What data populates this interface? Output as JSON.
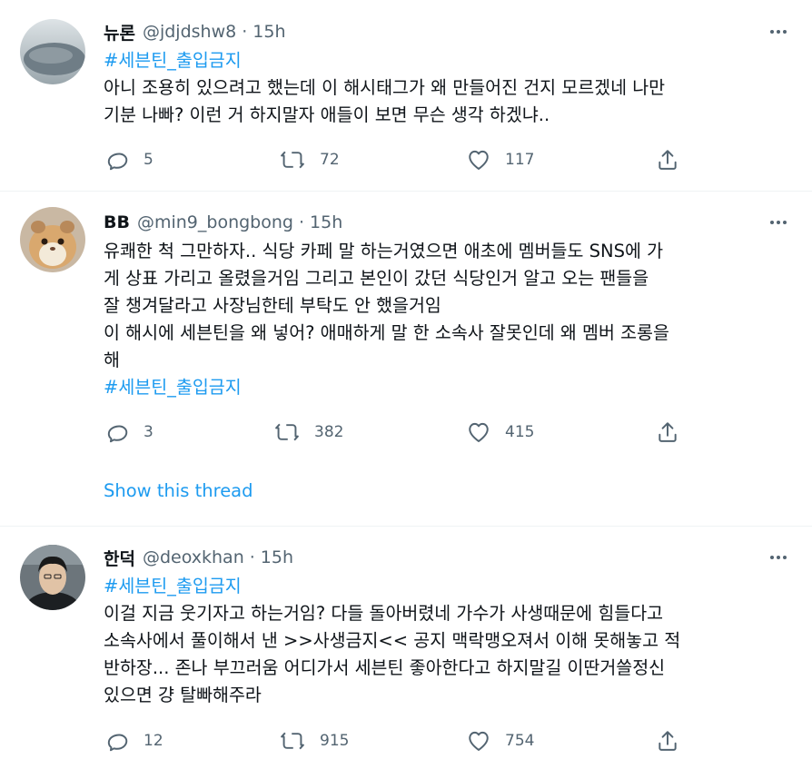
{
  "tweets": [
    {
      "display_name": "뉴론",
      "handle": "@jdjdshw8",
      "separator": "·",
      "time": "15h",
      "hashtag_top": "#세븐틴_출입금지",
      "lines": [
        "아니 조용히 있으려고 했는데 이 해시태그가 왜 만들어진 건지 모르겠네 나만",
        "기분 나빠? 이런 거 하지말자 애들이 보면 무슨 생각 하겠냐.."
      ],
      "hashtag_bottom": "",
      "replies": "5",
      "retweets": "72",
      "likes": "117"
    },
    {
      "display_name": "BB",
      "handle": "@min9_bongbong",
      "separator": "·",
      "time": "15h",
      "hashtag_top": "",
      "lines": [
        "유쾌한 척 그만하자.. 식당 카페 말 하는거였으면 애초에 멤버들도 SNS에 가",
        "게 상표 가리고 올렸을거임 그리고 본인이 갔던 식당인거 알고 오는 팬들을",
        "잘 챙겨달라고 사장님한테 부탁도 안 했을거임",
        "이 해시에 세븐틴을 왜 넣어? 애매하게 말 한 소속사 잘못인데 왜 멤버 조롱을",
        "해"
      ],
      "hashtag_bottom": "#세븐틴_출입금지",
      "replies": "3",
      "retweets": "382",
      "likes": "415",
      "show_thread": "Show this thread"
    },
    {
      "display_name": "한덕",
      "handle": "@deoxkhan",
      "separator": "·",
      "time": "15h",
      "hashtag_top": "#세븐틴_출입금지",
      "lines": [
        "이걸 지금 웃기자고 하는거임? 다들 돌아버렸네 가수가 사생때문에 힘들다고",
        "소속사에서 풀이해서 낸 >>사생금지<< 공지 맥락맹오져서 이해 못해놓고 적",
        "반하장... 존나 부끄러움 어디가서 세븐틴 좋아한다고 하지말길 이딴거쓸정신",
        "있으면 걍 탈빠해주라"
      ],
      "hashtag_bottom": "",
      "replies": "12",
      "retweets": "915",
      "likes": "754"
    }
  ],
  "icons": {
    "more": "more-icon",
    "reply": "reply-icon",
    "retweet": "retweet-icon",
    "like": "heart-icon",
    "share": "share-icon"
  },
  "colors": {
    "link": "#1d9bf0",
    "secondary_text": "#536471",
    "divider": "#eff3f4"
  }
}
